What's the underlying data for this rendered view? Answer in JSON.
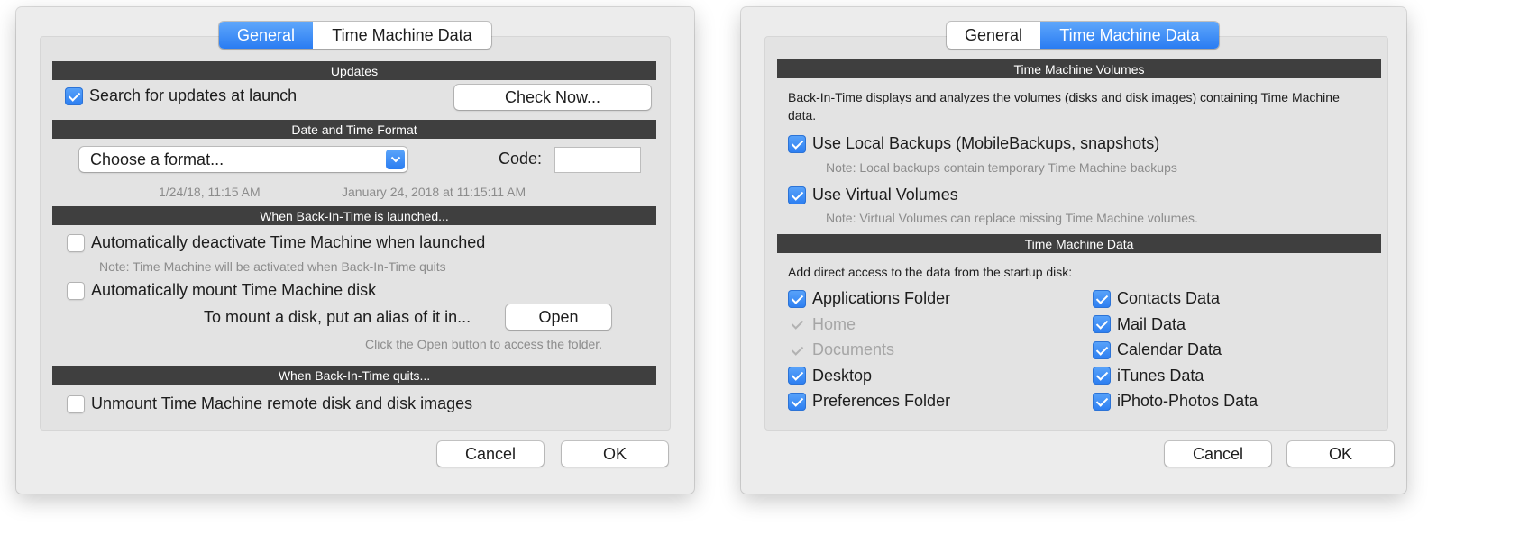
{
  "general": {
    "tabs": [
      "General",
      "Time Machine Data"
    ],
    "updates": {
      "header": "Updates",
      "search_label": "Search for updates at launch",
      "check_now_label": "Check Now..."
    },
    "datetime": {
      "header": "Date and Time Format",
      "format_select": "Choose a format...",
      "code_label": "Code:",
      "code_value": "",
      "example_short": "1/24/18, 11:15 AM",
      "example_long": "January 24, 2018 at 11:15:11 AM"
    },
    "launch": {
      "header": "When Back-In-Time is launched...",
      "deactivate_label": "Automatically deactivate Time Machine when launched",
      "deactivate_note": "Note: Time Machine will be activated when Back-In-Time quits",
      "mount_label": "Automatically mount Time Machine disk",
      "alias_text": "To mount a disk, put an alias of it in...",
      "open_label": "Open",
      "open_note": "Click the Open button to access the folder."
    },
    "quit": {
      "header": "When Back-In-Time quits...",
      "unmount_label": "Unmount Time Machine remote disk and disk images"
    },
    "cancel_label": "Cancel",
    "ok_label": "OK"
  },
  "tm": {
    "tabs": [
      "General",
      "Time Machine Data"
    ],
    "volumes": {
      "header": "Time Machine Volumes",
      "description": "Back-In-Time displays and analyzes the volumes (disks and disk images) containing Time Machine data.",
      "local_label": "Use Local Backups (MobileBackups, snapshots)",
      "local_note": "Note: Local backups contain temporary Time Machine backups",
      "virtual_label": "Use Virtual Volumes",
      "virtual_note": "Note: Virtual Volumes can replace missing Time Machine volumes."
    },
    "data": {
      "header": "Time Machine Data",
      "intro": "Add direct access to the data from the startup disk:",
      "left": [
        {
          "label": "Applications Folder",
          "state": "on"
        },
        {
          "label": "Home",
          "state": "dim"
        },
        {
          "label": "Documents",
          "state": "dim"
        },
        {
          "label": "Desktop",
          "state": "on"
        },
        {
          "label": "Preferences Folder",
          "state": "on"
        }
      ],
      "right": [
        {
          "label": "Contacts Data",
          "state": "on"
        },
        {
          "label": "Mail Data",
          "state": "on"
        },
        {
          "label": "Calendar Data",
          "state": "on"
        },
        {
          "label": "iTunes Data",
          "state": "on"
        },
        {
          "label": "iPhoto-Photos Data",
          "state": "on"
        }
      ]
    },
    "cancel_label": "Cancel",
    "ok_label": "OK"
  },
  "colors": {
    "accent": "#2b7df1",
    "bar": "#3f3f3f",
    "note": "#8c8c8c"
  }
}
